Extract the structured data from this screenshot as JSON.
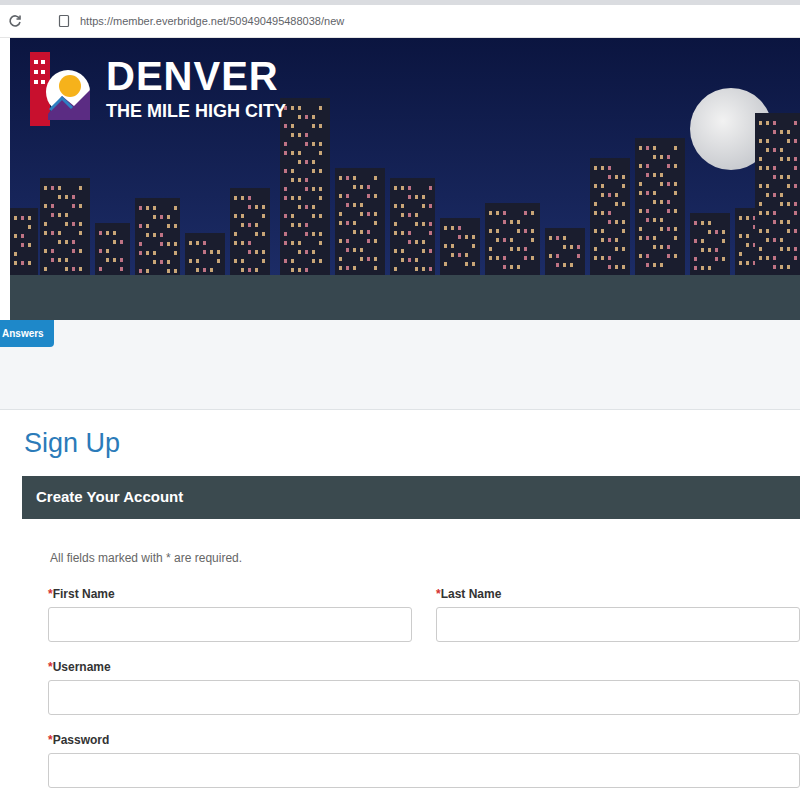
{
  "browser": {
    "url": "https://member.everbridge.net/509490495488038/new"
  },
  "banner": {
    "title": "DENVER",
    "subtitle": "THE MILE HIGH CITY"
  },
  "tabs": [
    {
      "label": "Answers",
      "selected": true
    }
  ],
  "page": {
    "heading": "Sign Up",
    "section": "Create Your Account",
    "note": "All fields marked with * are required."
  },
  "fields": [
    {
      "label": "First Name",
      "marker": "*",
      "value": ""
    },
    {
      "label": "Last Name",
      "marker": "*",
      "value": ""
    },
    {
      "label": "Username",
      "marker": "*",
      "value": ""
    },
    {
      "label": "Password",
      "marker": "*",
      "value": ""
    }
  ]
}
